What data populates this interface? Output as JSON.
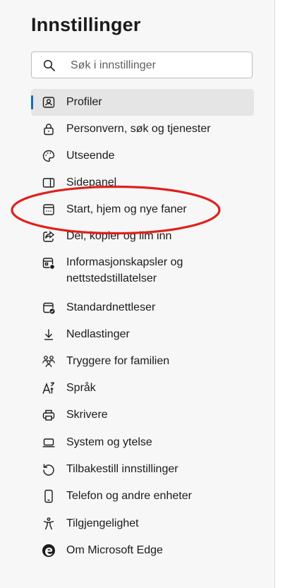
{
  "page": {
    "title": "Innstillinger"
  },
  "search": {
    "placeholder": "Søk i innstillinger",
    "value": ""
  },
  "colors": {
    "accent": "#0f6cbd",
    "annotation": "#e0201b",
    "selected_bg": "#e5e5e5"
  },
  "nav": {
    "items": [
      {
        "label": "Profiler",
        "icon": "profile-icon",
        "selected": true
      },
      {
        "label": "Personvern, søk og tjenester",
        "icon": "lock-icon"
      },
      {
        "label": "Utseende",
        "icon": "palette-icon"
      },
      {
        "label": "Sidepanel",
        "icon": "sidebar-icon"
      },
      {
        "label": "Start, hjem og nye faner",
        "icon": "new-tab-icon"
      },
      {
        "label": "Del, kopier og lim inn",
        "icon": "share-icon"
      },
      {
        "label": "Informasjonskapsler og nettstedstillatelser",
        "icon": "cookies-site-permissions-icon"
      },
      {
        "label": "Standardnettleser",
        "icon": "default-browser-icon"
      },
      {
        "label": "Nedlastinger",
        "icon": "download-icon"
      },
      {
        "label": "Tryggere for familien",
        "icon": "family-icon"
      },
      {
        "label": "Språk",
        "icon": "language-icon"
      },
      {
        "label": "Skrivere",
        "icon": "printer-icon"
      },
      {
        "label": "System og ytelse",
        "icon": "laptop-icon"
      },
      {
        "label": "Tilbakestill innstillinger",
        "icon": "reset-icon"
      },
      {
        "label": "Telefon og andre enheter",
        "icon": "phone-icon"
      },
      {
        "label": "Tilgjengelighet",
        "icon": "accessibility-icon"
      },
      {
        "label": "Om Microsoft Edge",
        "icon": "edge-logo-icon"
      }
    ]
  }
}
